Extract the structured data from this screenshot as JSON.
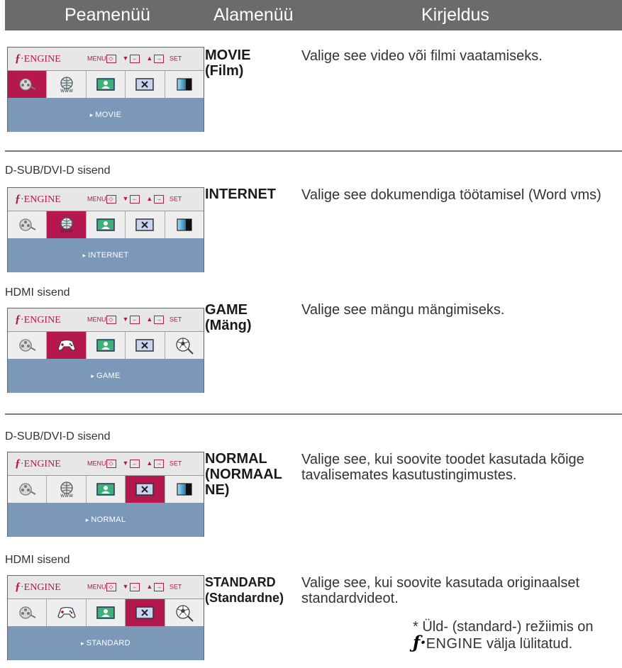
{
  "header": {
    "col1": "Peamenüü",
    "col2": "Alamenüü",
    "col3": "Kirjeldus"
  },
  "osd": {
    "logo_text": "ENGINE",
    "controls_text": "MENU ▼ ▲ SET"
  },
  "sections": [
    {
      "caption": "",
      "panel_label": "MOVIE",
      "selected": 0,
      "icons": [
        "film-reel-icon",
        "www-globe-icon",
        "picture-icon",
        "close-box-icon",
        "gradient-box-icon"
      ],
      "submenu": [
        "MOVIE",
        "(Film)"
      ],
      "description": "Valige see video või filmi vaatamiseks."
    },
    {
      "caption": "D-SUB/DVI-D sisend",
      "panel_label": "INTERNET",
      "selected": 1,
      "icons": [
        "film-reel-icon",
        "www-globe-icon",
        "picture-icon",
        "close-box-icon",
        "gradient-box-icon"
      ],
      "submenu": [
        "INTERNET",
        ""
      ],
      "description": "Valige see dokumendiga töötamisel (Word vms)"
    },
    {
      "caption": "HDMI sisend",
      "panel_label": "GAME",
      "selected": 1,
      "icons": [
        "film-reel-icon",
        "gamepad-icon",
        "picture-icon",
        "close-box-icon",
        "soccer-ball-icon"
      ],
      "submenu": [
        "GAME",
        "(Mäng)"
      ],
      "description": "Valige see mängu mängimiseks."
    },
    {
      "caption": "D-SUB/DVI-D sisend",
      "panel_label": "NORMAL",
      "selected": 3,
      "icons": [
        "film-reel-icon",
        "www-globe-icon",
        "picture-icon",
        "close-box-icon",
        "gradient-box-icon"
      ],
      "submenu": [
        "NORMAL",
        "(NORMAAL",
        "NE)"
      ],
      "description": "Valige see, kui soovite toodet kasutada kõige tavalisemates kasutustingimustes."
    },
    {
      "caption": "HDMI sisend",
      "panel_label": "STANDARD",
      "selected": 3,
      "icons": [
        "film-reel-icon",
        "gamepad-icon",
        "picture-icon",
        "close-box-icon",
        "soccer-ball-icon"
      ],
      "submenu": [
        "STANDARD",
        "(Standardne)"
      ],
      "description": "Valige see, kui soovite kasutada originaalset standardvideot."
    }
  ],
  "note": {
    "prefix": "* Üld- (standard-) režiimis on",
    "engine": "ENGINE",
    "suffix": "välja lülitatud."
  },
  "colors": {
    "header": "#6b6b6b",
    "selected": "#b5174f",
    "panel_bar": "#7c98b8"
  }
}
